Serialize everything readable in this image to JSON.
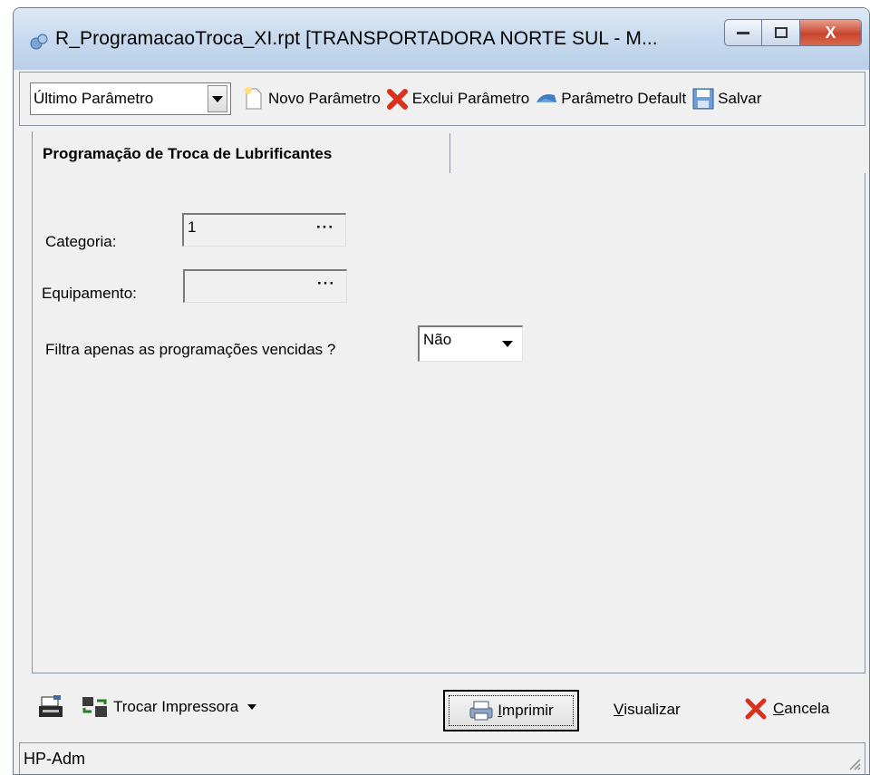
{
  "window": {
    "title": "R_ProgramacaoTroca_XI.rpt [TRANSPORTADORA NORTE SUL -  M...",
    "minimize": "—",
    "maximize": "□",
    "close": "X"
  },
  "toolbar": {
    "param_select": "Último Parâmetro",
    "novo": "Novo Parâmetro",
    "exclui": "Exclui Parâmetro",
    "default": "Parâmetro Default",
    "salvar": "Salvar"
  },
  "tab": {
    "label": "Programação de Troca de Lubrificantes"
  },
  "form": {
    "categoria_label": "Categoria:",
    "categoria_value": "1",
    "equipamento_label": "Equipamento:",
    "equipamento_value": "",
    "lookup_dots": "···",
    "filtra_label": "Filtra apenas as programações vencidas ?",
    "filtra_value": "Não"
  },
  "bottom": {
    "trocar": "Trocar Impressora",
    "imprimir_rest": "mprimir",
    "imprimir_key": "I",
    "visualizar_key": "V",
    "visualizar_rest": "isualizar",
    "cancela_key": "C",
    "cancela_rest": "ancela"
  },
  "status": {
    "text": "HP-Adm"
  },
  "colors": {
    "accent": "#c8452d",
    "frame": "#8a96a3",
    "panel": "#f0f0f0"
  }
}
